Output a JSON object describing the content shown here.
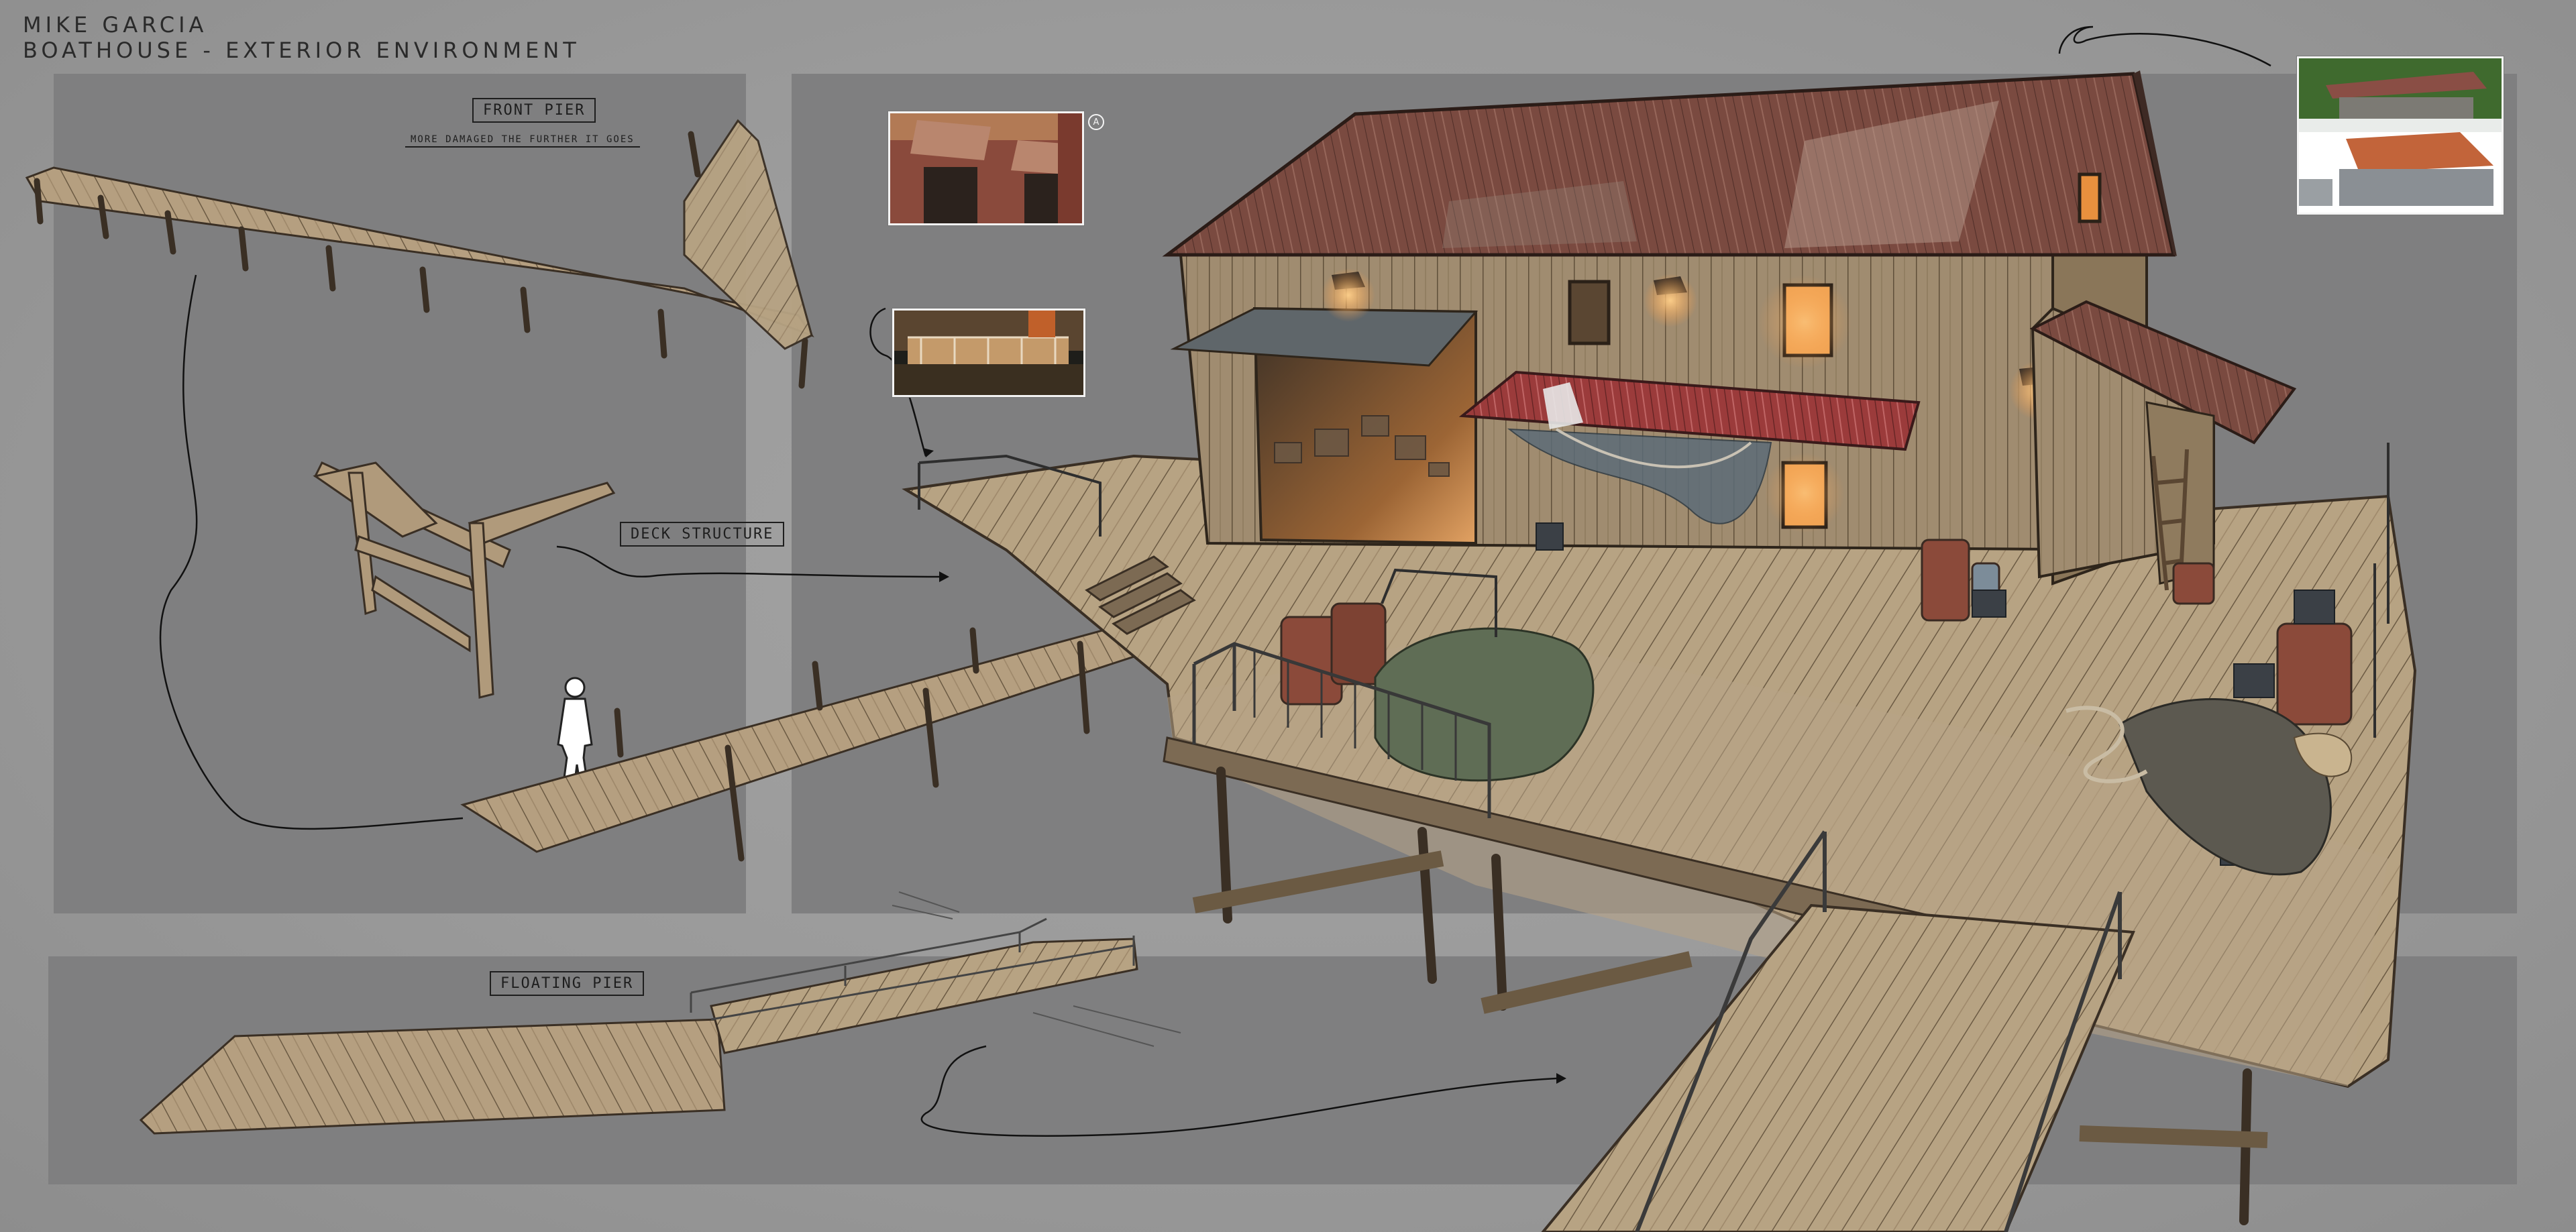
{
  "header": {
    "artist": "MIKE GARCIA",
    "title": "BOATHOUSE - EXTERIOR ENVIRONMENT"
  },
  "annotations": {
    "front_pier": "FRONT PIER",
    "front_pier_note": "MORE DAMAGED THE FURTHER IT GOES",
    "deck_structure": "DECK STRUCTURE",
    "floating_pier": "FLOATING PIER",
    "callout_marker": "A"
  },
  "colors": {
    "panel": "#7f7f80",
    "background": "#9e9e9e",
    "wood": "#b39f82",
    "roof_rust": "#7d4a40",
    "awning_red": "#9b3b3b",
    "barrel_rust": "#8b4a3a",
    "tarp_green": "#5f6d55",
    "lamp_glow": "#ffb060"
  }
}
